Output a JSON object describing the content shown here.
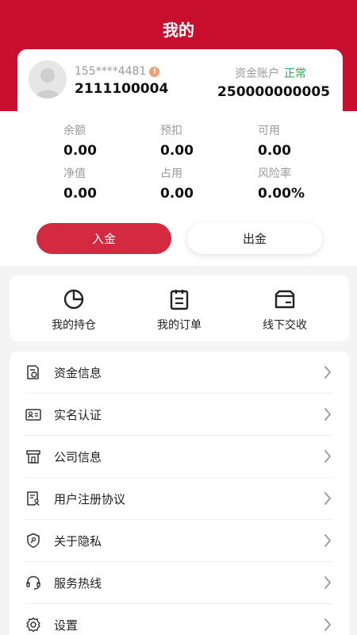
{
  "header": {
    "title": "我的"
  },
  "account": {
    "phone_masked": "155****4481",
    "user_id": "2111100004",
    "fund_account_label": "资金账户",
    "fund_account_status": "正常",
    "fund_account_number": "250000000005"
  },
  "stats": [
    {
      "label": "余额",
      "value": "0.00"
    },
    {
      "label": "预扣",
      "value": "0.00"
    },
    {
      "label": "可用",
      "value": "0.00"
    },
    {
      "label": "净值",
      "value": "0.00"
    },
    {
      "label": "占用",
      "value": "0.00"
    },
    {
      "label": "风险率",
      "value": "0.00%"
    }
  ],
  "actions": {
    "deposit": "入金",
    "withdraw": "出金"
  },
  "quick": [
    {
      "label": "我的持仓",
      "icon": "pie-chart-icon"
    },
    {
      "label": "我的订单",
      "icon": "clipboard-icon"
    },
    {
      "label": "线下交收",
      "icon": "delivery-box-icon"
    }
  ],
  "menu": [
    {
      "label": "资金信息",
      "icon": "fund-document-icon"
    },
    {
      "label": "实名认证",
      "icon": "id-card-icon"
    },
    {
      "label": "公司信息",
      "icon": "company-icon"
    },
    {
      "label": "用户注册协议",
      "icon": "agreement-icon"
    },
    {
      "label": "关于隐私",
      "icon": "privacy-shield-icon"
    },
    {
      "label": "服务热线",
      "icon": "headset-icon"
    },
    {
      "label": "设置",
      "icon": "gear-icon"
    }
  ],
  "colors": {
    "brand_red": "#c8102e",
    "button_red": "#d42a3f",
    "status_green": "#2aa84a"
  }
}
